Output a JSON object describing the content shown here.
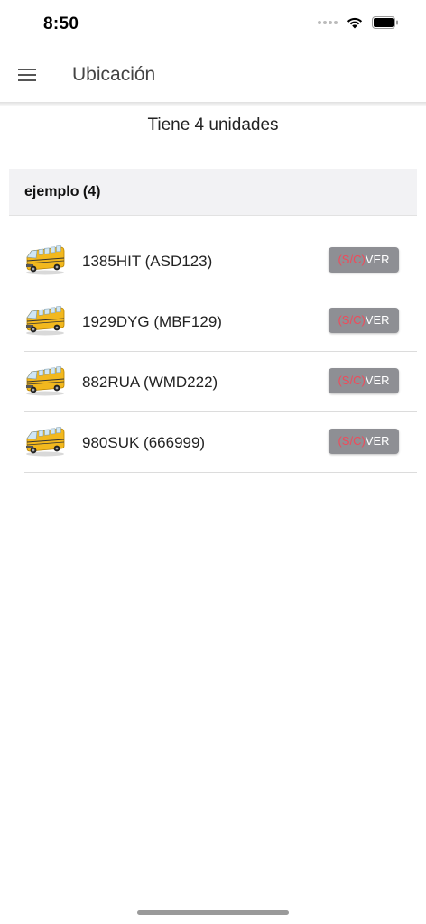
{
  "status_bar": {
    "time": "8:50"
  },
  "app_bar": {
    "title": "Ubicación",
    "menu_icon": "hamburger-menu-icon"
  },
  "summary": {
    "text": "Tiene 4 unidades"
  },
  "group": {
    "title": "ejemplo (4)"
  },
  "units": [
    {
      "label": "1385HIT (ASD123)",
      "status": "(S/C)",
      "action": "VER"
    },
    {
      "label": "1929DYG (MBF129)",
      "status": "(S/C)",
      "action": "VER"
    },
    {
      "label": "882RUA (WMD222)",
      "status": "(S/C)",
      "action": "VER"
    },
    {
      "label": "980SUK (666999)",
      "status": "(S/C)",
      "action": "VER"
    }
  ],
  "colors": {
    "accent_status": "#f04a5a",
    "button_bg": "#8e8f94",
    "bus": "#f2b81e"
  }
}
